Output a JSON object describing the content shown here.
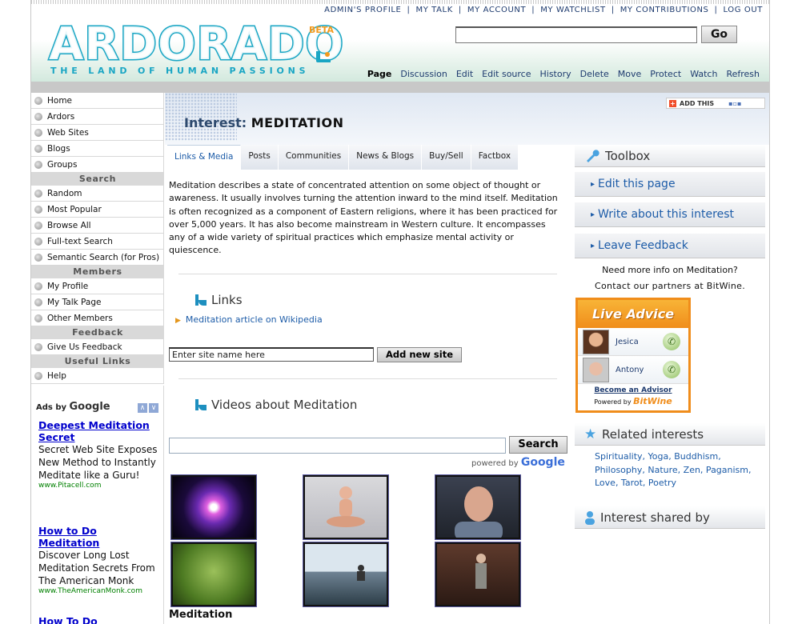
{
  "topnav": [
    "ADMIN'S PROFILE",
    "MY TALK",
    "MY ACCOUNT",
    "MY WATCHLIST",
    "MY CONTRIBUTIONS",
    "LOG OUT"
  ],
  "logo": {
    "name": "ARDORADO",
    "beta": "BETA",
    "tagline": "THE LAND OF HUMAN PASSIONS"
  },
  "search": {
    "go_label": "Go"
  },
  "actions": [
    "Page",
    "Discussion",
    "Edit",
    "Edit source",
    "History",
    "Delete",
    "Move",
    "Protect",
    "Watch",
    "Refresh"
  ],
  "sidebar": {
    "main": [
      "Home",
      "Ardors",
      "Web Sites",
      "Blogs",
      "Groups"
    ],
    "search_head": "Search",
    "search": [
      "Random",
      "Most Popular",
      "Browse All",
      "Full-text Search",
      "Semantic Search (for Pros)"
    ],
    "members_head": "Members",
    "members": [
      "My Profile",
      "My Talk Page",
      "Other Members"
    ],
    "feedback_head": "Feedback",
    "feedback": [
      "Give Us Feedback"
    ],
    "useful_head": "Useful Links",
    "useful": [
      "Help"
    ]
  },
  "ads": {
    "ads_by": "Ads by",
    "google": "Google",
    "items": [
      {
        "title": "Deepest Meditation Secret",
        "desc": "Secret Web Site Exposes New Method to Instantly Meditate like a Guru!",
        "url": "www.Pitacell.com"
      },
      {
        "title": "How to Do Meditation",
        "desc": "Discover Long Lost Meditation Secrets From The American Monk",
        "url": "www.TheAmericanMonk.com"
      },
      {
        "title": "How To Do Meditation?",
        "desc": "",
        "url": ""
      }
    ]
  },
  "banner": {
    "prefix": "Interest:",
    "name": "MEDITATION",
    "addthis": "ADD THIS"
  },
  "tabs": [
    "Links & Media",
    "Posts",
    "Communities",
    "News & Blogs",
    "Buy/Sell",
    "Factbox"
  ],
  "description": "Meditation describes a state of concentrated attention on some object of thought or awareness. It usually involves turning the attention inward to the mind itself. Meditation is often recognized as a component of Eastern religions, where it has been practiced for over 5,000 years. It has also become mainstream in Western culture. It encompasses any of a wide variety of spiritual practices which emphasize mental activity or quiescence.",
  "links": {
    "title": "Links",
    "items": [
      "Meditation article on Wikipedia"
    ],
    "input_placeholder": "Enter site name here",
    "add_label": "Add new site"
  },
  "videos": {
    "title": "Videos about Meditation",
    "search_label": "Search",
    "powered": "powered by",
    "google": "Google",
    "caption": "Meditation"
  },
  "toolbox": {
    "title": "Toolbox",
    "buttons": [
      "Edit this page",
      "Write about this interest",
      "Leave Feedback"
    ],
    "info1": "Need more info on Meditation?",
    "info2": "Contact our partners at BitWine."
  },
  "live_advice": {
    "title": "Live Advice",
    "advisors": [
      "Jesica",
      "Antony"
    ],
    "become": "Become an Advisor",
    "powered": "Powered by",
    "brand": "BitWine"
  },
  "related": {
    "title": "Related interests",
    "items": "Spirituality, Yoga, Buddhism, Philosophy, Nature, Zen, Paganism, Love, Tarot, Poetry"
  },
  "shared": {
    "title": "Interest shared by"
  }
}
